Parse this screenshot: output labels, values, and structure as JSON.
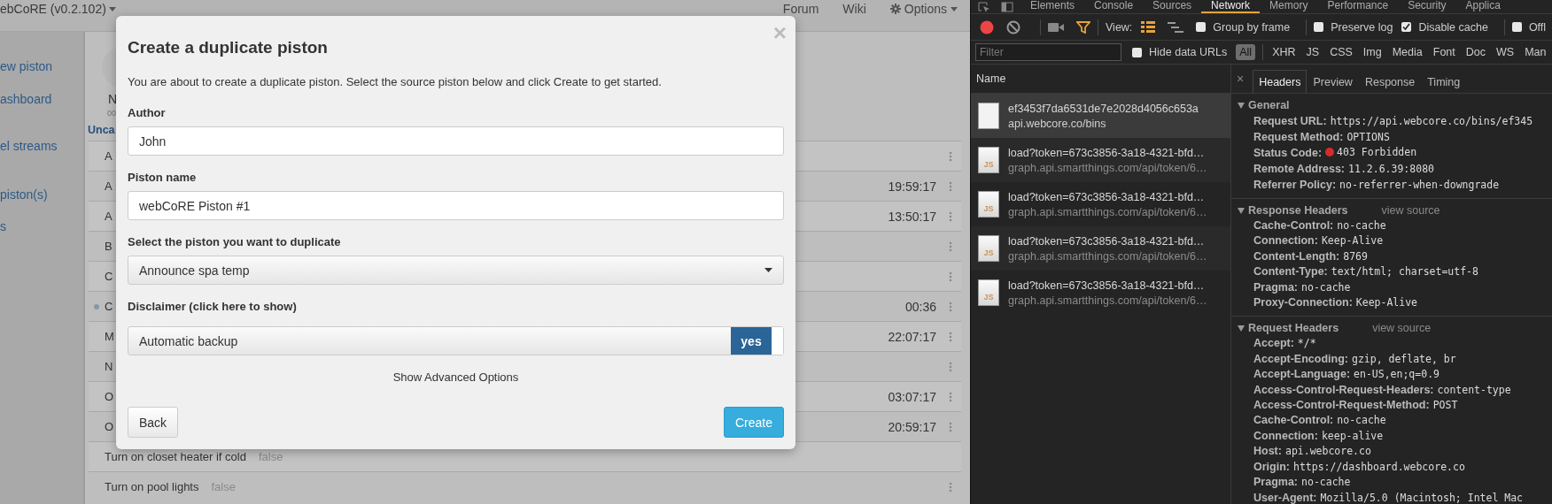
{
  "app": {
    "brand": "ebCoRE (v0.2.102)",
    "nav": [
      {
        "label": "Forum",
        "kind": "link"
      },
      {
        "label": "Wiki",
        "kind": "link"
      },
      {
        "label": "Options",
        "kind": "menu"
      }
    ],
    "sidebar": [
      {
        "label": "ew piston"
      },
      {
        "label": "ashboard"
      },
      {
        "label": "el streams"
      },
      {
        "label": "piston(s)"
      },
      {
        "label": "s"
      }
    ],
    "user": {
      "initial": "N",
      "sub": "00"
    },
    "group": "Unca",
    "pistons": [
      {
        "name": "A",
        "running": false,
        "menu": true
      },
      {
        "name": "A",
        "time": "19:59:17",
        "running": false,
        "menu": true
      },
      {
        "name": "A",
        "time": "13:50:17",
        "running": false,
        "menu": true
      },
      {
        "name": "B",
        "running": false,
        "menu": true
      },
      {
        "name": "C",
        "running": false,
        "menu": true
      },
      {
        "name": "C",
        "time": "00:36",
        "running": true,
        "menu": true
      },
      {
        "name": "M",
        "time": "22:07:17",
        "running": false,
        "menu": true
      },
      {
        "name": "N",
        "running": false,
        "menu": true
      },
      {
        "name": "O",
        "time": "03:07:17",
        "running": false,
        "menu": true
      },
      {
        "name": "O",
        "time": "20:59:17",
        "running": false,
        "menu": true
      },
      {
        "name": "Turn on closet heater if cold",
        "status": "false",
        "running": false,
        "menu": false
      },
      {
        "name": "Turn on pool lights",
        "status": "false",
        "running": false,
        "menu": true
      }
    ]
  },
  "dialog": {
    "title": "Create a duplicate piston",
    "close": "×",
    "intro": "You are about to create a duplicate piston. Select the source piston below and click Create to get started.",
    "fields": [
      {
        "label": "Author",
        "value": "John"
      },
      {
        "label": "Piston name",
        "value": "webCoRE Piston #1"
      }
    ],
    "select": {
      "label": "Select the piston you want to duplicate",
      "value": "Announce spa temp"
    },
    "disclaimer": "Disclaimer (click here to show)",
    "toggle": {
      "label": "Automatic backup",
      "value": "yes",
      "on": true
    },
    "advanced": "Show Advanced Options",
    "buttons": [
      {
        "label": "Back",
        "kind": "default"
      },
      {
        "label": "Create",
        "kind": "primary"
      }
    ]
  },
  "devtools": {
    "tabs": [
      {
        "label": "Elements",
        "selected": false
      },
      {
        "label": "Console",
        "selected": false
      },
      {
        "label": "Sources",
        "selected": false
      },
      {
        "label": "Network",
        "selected": true
      },
      {
        "label": "Memory",
        "selected": false
      },
      {
        "label": "Performance",
        "selected": false
      },
      {
        "label": "Security",
        "selected": false
      },
      {
        "label": "Applica",
        "selected": false
      }
    ],
    "recording": true,
    "view_label": "View:",
    "checkboxes": [
      {
        "label": "Group by frame",
        "checked": false
      },
      {
        "label": "Preserve log",
        "checked": false
      },
      {
        "label": "Disable cache",
        "checked": true
      },
      {
        "label": "Offl",
        "checked": false
      }
    ],
    "filter": {
      "placeholder": "Filter"
    },
    "hide_data_urls": {
      "label": "Hide data URLs",
      "checked": false
    },
    "types": [
      {
        "label": "All",
        "selected": true
      },
      {
        "label": "XHR",
        "selected": false
      },
      {
        "label": "JS",
        "selected": false
      },
      {
        "label": "CSS",
        "selected": false
      },
      {
        "label": "Img",
        "selected": false
      },
      {
        "label": "Media",
        "selected": false
      },
      {
        "label": "Font",
        "selected": false
      },
      {
        "label": "Doc",
        "selected": false
      },
      {
        "label": "WS",
        "selected": false
      },
      {
        "label": "Man",
        "selected": false
      }
    ],
    "name_header": "Name",
    "requests": [
      {
        "name": "ef3453f7da6531de7e2028d4056c653a",
        "host": "api.webcore.co/bins",
        "kind": "document",
        "selected": true
      },
      {
        "name": "load?token=673c3856-3a18-4321-bfd…",
        "host": "graph.api.smartthings.com/api/token/6…",
        "kind": "script",
        "badge": "JS",
        "selected": false
      },
      {
        "name": "load?token=673c3856-3a18-4321-bfd…",
        "host": "graph.api.smartthings.com/api/token/6…",
        "kind": "script",
        "badge": "JS",
        "selected": false
      },
      {
        "name": "load?token=673c3856-3a18-4321-bfd…",
        "host": "graph.api.smartthings.com/api/token/6…",
        "kind": "script",
        "badge": "JS",
        "selected": false
      },
      {
        "name": "load?token=673c3856-3a18-4321-bfd…",
        "host": "graph.api.smartthings.com/api/token/6…",
        "kind": "script",
        "badge": "JS",
        "selected": false
      }
    ],
    "detail_close": "×",
    "detail_tabs": [
      {
        "label": "Headers",
        "selected": true
      },
      {
        "label": "Preview",
        "selected": false
      },
      {
        "label": "Response",
        "selected": false
      },
      {
        "label": "Timing",
        "selected": false
      }
    ],
    "sections": [
      {
        "title": "General",
        "expanded": true,
        "entries": [
          {
            "key": "Request URL:",
            "value": "https://api.webcore.co/bins/ef345"
          },
          {
            "key": "Request Method:",
            "value": "OPTIONS"
          },
          {
            "key": "Status Code:",
            "value": "403 Forbidden",
            "kind": "status",
            "color": "#d62b2b"
          },
          {
            "key": "Remote Address:",
            "value": "11.2.6.39:8080"
          },
          {
            "key": "Referrer Policy:",
            "value": "no-referrer-when-downgrade"
          }
        ]
      },
      {
        "title": "Response Headers",
        "view_source": "view source",
        "expanded": true,
        "entries": [
          {
            "key": "Cache-Control:",
            "value": "no-cache"
          },
          {
            "key": "Connection:",
            "value": "Keep-Alive"
          },
          {
            "key": "Content-Length:",
            "value": "8769"
          },
          {
            "key": "Content-Type:",
            "value": "text/html; charset=utf-8"
          },
          {
            "key": "Pragma:",
            "value": "no-cache"
          },
          {
            "key": "Proxy-Connection:",
            "value": "Keep-Alive"
          }
        ]
      },
      {
        "title": "Request Headers",
        "view_source": "view source",
        "expanded": true,
        "entries": [
          {
            "key": "Accept:",
            "value": "*/*"
          },
          {
            "key": "Accept-Encoding:",
            "value": "gzip, deflate, br"
          },
          {
            "key": "Accept-Language:",
            "value": "en-US,en;q=0.9"
          },
          {
            "key": "Access-Control-Request-Headers:",
            "value": "content-type"
          },
          {
            "key": "Access-Control-Request-Method:",
            "value": "POST"
          },
          {
            "key": "Cache-Control:",
            "value": "no-cache"
          },
          {
            "key": "Connection:",
            "value": "keep-alive"
          },
          {
            "key": "Host:",
            "value": "api.webcore.co"
          },
          {
            "key": "Origin:",
            "value": "https://dashboard.webcore.co"
          },
          {
            "key": "Pragma:",
            "value": "no-cache"
          },
          {
            "key": "User-Agent:",
            "value": "Mozilla/5.0 (Macintosh; Intel Mac"
          }
        ]
      }
    ]
  }
}
